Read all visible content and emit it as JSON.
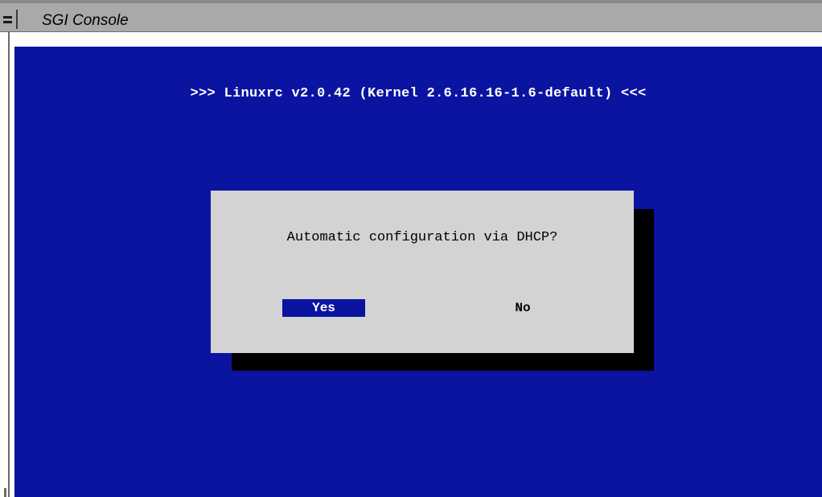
{
  "window": {
    "title": "SGI Console"
  },
  "console": {
    "header": ">>> Linuxrc v2.0.42 (Kernel 2.6.16.16-1.6-default) <<<"
  },
  "dialog": {
    "question": "Automatic configuration via DHCP?",
    "yes_label": "Yes",
    "no_label": "No",
    "selected": "Yes"
  },
  "colors": {
    "console_background": "#0a14a0",
    "dialog_background": "#d3d3d3",
    "dialog_shadow": "#000000",
    "titlebar": "#a9a9a9"
  }
}
